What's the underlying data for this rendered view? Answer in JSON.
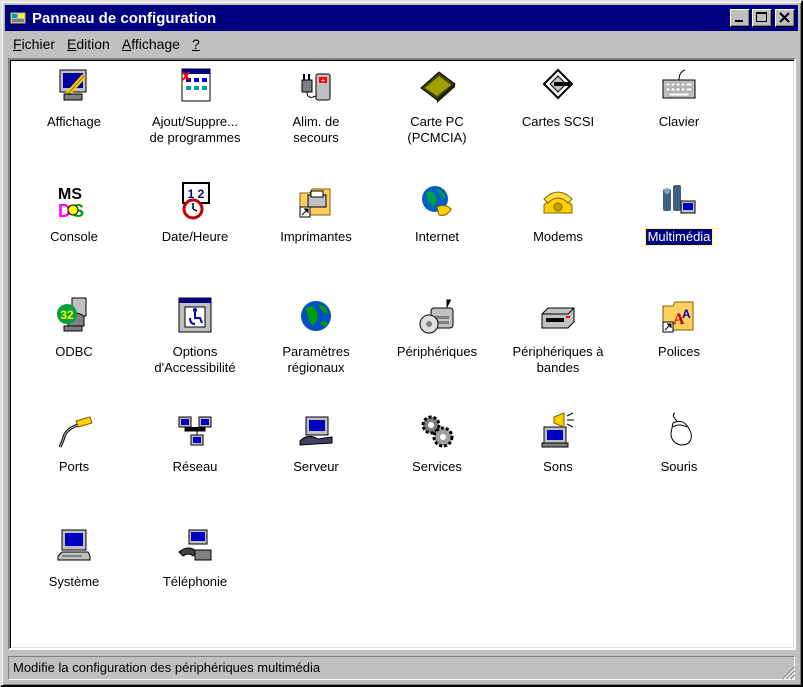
{
  "window": {
    "title": "Panneau de configuration",
    "buttons": {
      "minimize": "minimize-icon",
      "maximize": "maximize-icon",
      "close": "close-icon"
    }
  },
  "menu": [
    {
      "label": "Fichier",
      "accel": "F",
      "rest": "ichier"
    },
    {
      "label": "Edition",
      "accel": "E",
      "rest": "dition"
    },
    {
      "label": "Affichage",
      "accel": "A",
      "rest": "ffichage"
    },
    {
      "label": "?",
      "accel": "?",
      "rest": ""
    }
  ],
  "items": [
    {
      "label": "Affichage",
      "icon": "display-icon",
      "selected": false
    },
    {
      "label": "Ajout/Suppre...\nde programmes",
      "icon": "add-remove-programs-icon",
      "selected": false
    },
    {
      "label": "Alim. de\nsecours",
      "icon": "ups-power-icon",
      "selected": false
    },
    {
      "label": "Carte PC\n(PCMCIA)",
      "icon": "pc-card-icon",
      "selected": false
    },
    {
      "label": "Cartes SCSI",
      "icon": "scsi-icon",
      "selected": false
    },
    {
      "label": "Clavier",
      "icon": "keyboard-icon",
      "selected": false
    },
    {
      "label": "Console",
      "icon": "msdos-console-icon",
      "selected": false
    },
    {
      "label": "Date/Heure",
      "icon": "date-time-icon",
      "selected": false
    },
    {
      "label": "Imprimantes",
      "icon": "printers-folder-icon",
      "selected": false
    },
    {
      "label": "Internet",
      "icon": "internet-icon",
      "selected": false
    },
    {
      "label": "Modems",
      "icon": "modem-phone-icon",
      "selected": false
    },
    {
      "label": "Multimédia",
      "icon": "multimedia-icon",
      "selected": true
    },
    {
      "label": "ODBC",
      "icon": "odbc-icon",
      "selected": false
    },
    {
      "label": "Options\nd'Accessibilité",
      "icon": "accessibility-icon",
      "selected": false
    },
    {
      "label": "Paramètres\nrégionaux",
      "icon": "globe-icon",
      "selected": false
    },
    {
      "label": "Périphériques",
      "icon": "devices-icon",
      "selected": false
    },
    {
      "label": "Périphériques à\nbandes",
      "icon": "tape-drive-icon",
      "selected": false
    },
    {
      "label": "Polices",
      "icon": "fonts-folder-icon",
      "selected": false
    },
    {
      "label": "Ports",
      "icon": "ports-cable-icon",
      "selected": false
    },
    {
      "label": "Réseau",
      "icon": "network-icon",
      "selected": false
    },
    {
      "label": "Serveur",
      "icon": "server-icon",
      "selected": false
    },
    {
      "label": "Services",
      "icon": "services-gears-icon",
      "selected": false
    },
    {
      "label": "Sons",
      "icon": "sounds-speaker-icon",
      "selected": false
    },
    {
      "label": "Souris",
      "icon": "mouse-icon",
      "selected": false
    },
    {
      "label": "Système",
      "icon": "system-computer-icon",
      "selected": false
    },
    {
      "label": "Téléphonie",
      "icon": "telephony-icon",
      "selected": false
    }
  ],
  "status": {
    "text": "Modifie la configuration des périphériques multimédia"
  },
  "colors": {
    "title_bg": "#000080",
    "face": "#c0c0c0",
    "selection": "#000080"
  }
}
